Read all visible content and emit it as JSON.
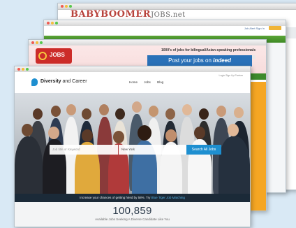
{
  "windows": {
    "babyboomer": {
      "brand_main": "BABYBOOMER",
      "brand_sfx": "JOBS.net"
    },
    "green_site": {
      "nav_links": "Job Alert  Sign In"
    },
    "bilingual": {
      "logo_text": "JOBS",
      "tagline": "1000's of jobs for bilingual/Asian-speaking professionals",
      "ad_text": "Post your jobs on",
      "ad_brand": "indeed"
    },
    "diversity": {
      "brand_main": "Diversity",
      "brand_rest": " and Career",
      "nav": [
        "Home",
        "Jobs",
        "Blog"
      ],
      "top_links": "Login  Sign Up  Partner",
      "search": {
        "keyword_placeholder": "Job title or Keyword",
        "location_value": "New York",
        "button_label": "Search All Jobs"
      },
      "promo": {
        "text": "Increase your chances of getting hired by 58%. Try ",
        "link": "Blue Tiger Job Matching"
      },
      "stats": {
        "count": "100,859",
        "label": "Available Jobs Seeking A Diverse Candidate Like You"
      }
    }
  },
  "colors": {
    "background": "#d9e9f5",
    "brand_blue": "#1e8fd0",
    "green_bar": "#3f8a25",
    "orange_sidebar": "#f5a623",
    "red_logo": "#cc2c29",
    "babyboomer_red": "#b8423b"
  }
}
